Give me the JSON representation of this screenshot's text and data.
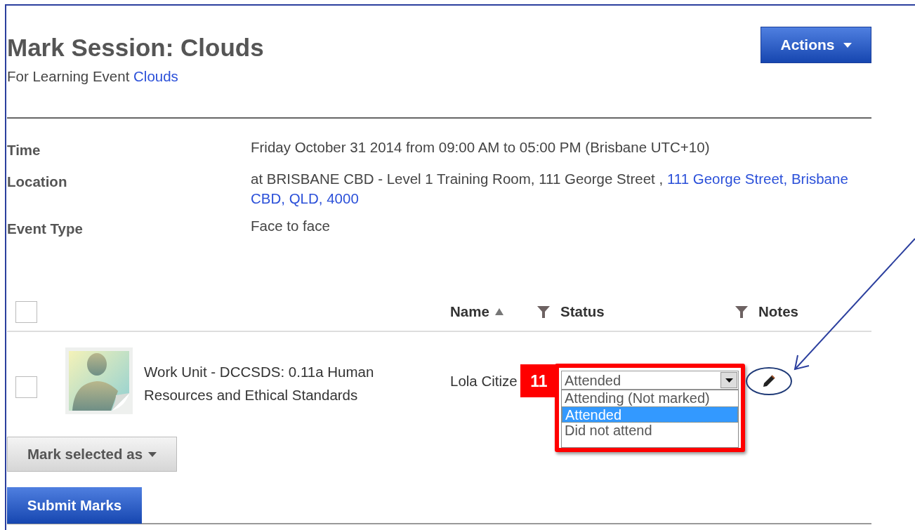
{
  "header": {
    "title": "Mark Session: Clouds",
    "subtitle": "For Learning Event",
    "subtitle_link": "Clouds"
  },
  "actions_button": {
    "label": "Actions"
  },
  "details": [
    {
      "label": "Time",
      "value": "Friday October 31 2014 from 09:00 AM to 05:00 PM (Brisbane UTC+10)"
    },
    {
      "label": "Location",
      "value": "at BRISBANE CBD - Level 1 Training Room, 111 George Street ,",
      "link_lines": [
        "111 George Street, Brisbane",
        "CBD, QLD, 4000"
      ]
    },
    {
      "label": "Event Type",
      "value": "Face to face"
    }
  ],
  "table": {
    "select_all": {
      "checked": false
    },
    "columns": [
      {
        "label": "Name",
        "sort_ascending": true,
        "filter": true
      },
      {
        "label": "Status",
        "filter": true
      },
      {
        "label": "Notes",
        "filter": false
      }
    ],
    "rows": [
      {
        "checked": false,
        "title": "Work Unit - DCCSDS: 0.11a Human Resources and Ethical Standards",
        "name": "Lola Citize",
        "status": "Attended",
        "expanded": true,
        "options": [
          {
            "label": "Attending (Not marked)",
            "selected": false
          },
          {
            "label": "Attended",
            "selected": true
          },
          {
            "label": "Did not attend",
            "selected": false
          }
        ]
      }
    ]
  },
  "callout": {
    "badge": "11"
  },
  "mark_selected_button": {
    "label": "Mark selected as"
  },
  "submit_button": {
    "label": "Submit Marks"
  }
}
